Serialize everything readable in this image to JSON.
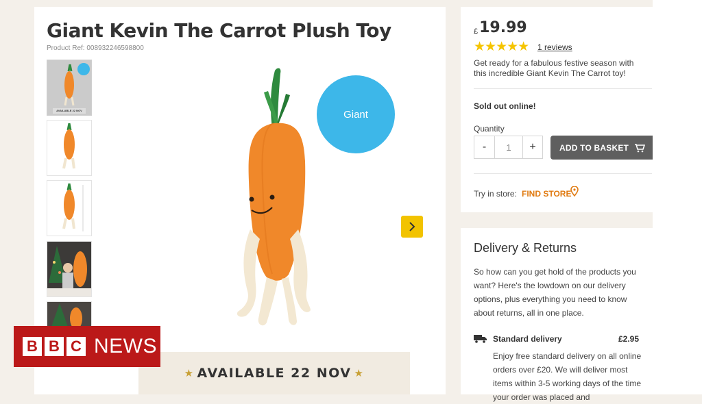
{
  "product": {
    "title": "Giant Kevin The Carrot Plush Toy",
    "ref": "Product Ref: 008932246598800",
    "bubble_text": "Giant",
    "banner": "AVAILABLE 22 NOV",
    "thumb_caption": "AVAILABLE 22 NOV",
    "next_icon": "chevron-right-icon"
  },
  "purchase": {
    "currency": "£",
    "price": "19.99",
    "rating_stars": 5,
    "rating_glyphs": "★★★★★",
    "reviews_link": "1 reviews",
    "description": "Get ready for a fabulous festive season with this incredible Giant Kevin The Carrot toy!",
    "stock_status": "Sold out online!",
    "quantity_label": "Quantity",
    "qty_minus": "-",
    "qty_value": "1",
    "qty_plus": "+",
    "add_to_basket": "ADD TO BASKET",
    "try_in_store": "Try in store:",
    "find_store": "FIND STORE"
  },
  "delivery": {
    "title": "Delivery & Returns",
    "intro": "So how can you get hold of the products you want? Here's the lowdown on our delivery options, plus everything you need to know about returns, all in one place.",
    "standard_label": "Standard delivery",
    "standard_price": "£2.95",
    "standard_text": "Enjoy free standard delivery on all online orders over £20. We will deliver most items within 3-5 working days of the time your order was placed and"
  },
  "watermark": {
    "letters": [
      "B",
      "B",
      "C"
    ],
    "news": "NEWS"
  },
  "colors": {
    "accent_yellow": "#f2c300",
    "bubble_blue": "#3db7e9",
    "find_store_orange": "#e07a10",
    "star_yellow": "#f5c400",
    "bbc_red": "#bb1919",
    "carrot_orange": "#f0882a",
    "leaf_green": "#2e8a3e"
  }
}
